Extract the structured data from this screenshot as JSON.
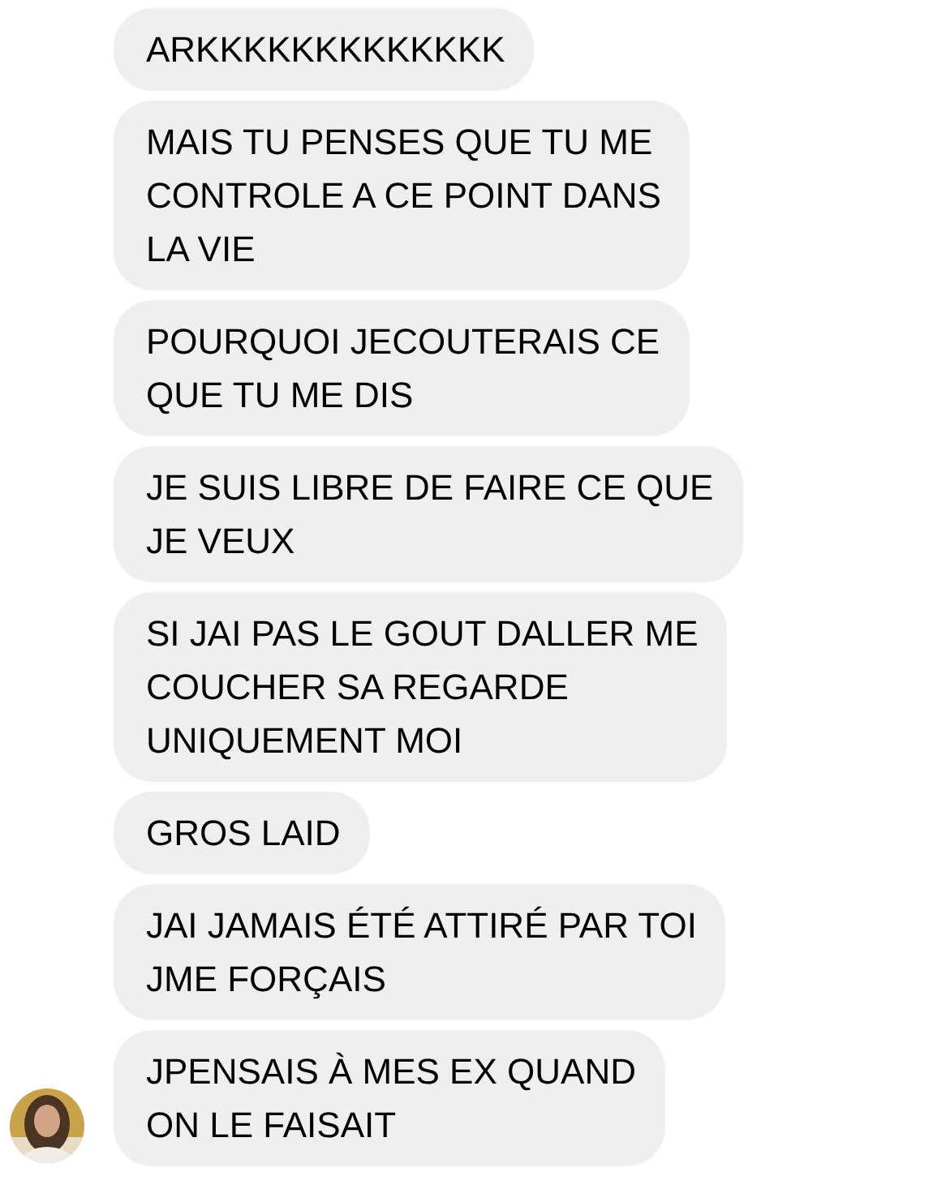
{
  "messages": [
    {
      "lines": [
        "ARKKKKKKKKKKKKK"
      ]
    },
    {
      "lines": [
        "MAIS TU PENSES QUE TU ME",
        "CONTROLE A CE POINT DANS",
        "LA VIE"
      ]
    },
    {
      "lines": [
        "POURQUOI JECOUTERAIS CE",
        "QUE TU ME DIS"
      ]
    },
    {
      "lines": [
        "JE SUIS LIBRE DE FAIRE CE QUE",
        "JE VEUX"
      ]
    },
    {
      "lines": [
        "SI JAI PAS LE GOUT DALLER ME",
        "COUCHER SA REGARDE",
        "UNIQUEMENT MOI"
      ]
    },
    {
      "lines": [
        "GROS LAID"
      ]
    },
    {
      "lines": [
        "JAI JAMAIS ÉTÉ ATTIRÉ PAR TOI",
        "JME FORÇAIS"
      ]
    },
    {
      "lines": [
        "JPENSAIS À MES EX QUAND",
        "ON LE FAISAIT"
      ]
    }
  ]
}
